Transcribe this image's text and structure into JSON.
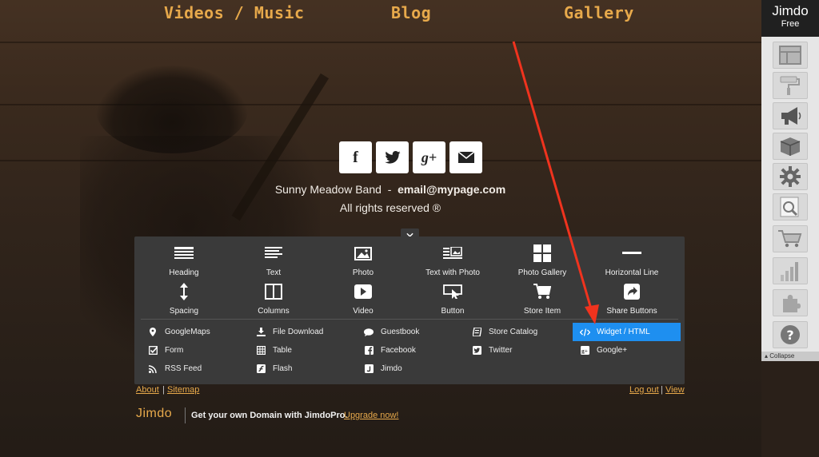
{
  "nav": {
    "items": [
      "Videos / Music",
      "Blog",
      "Gallery"
    ]
  },
  "social": {
    "buttons": [
      "f",
      "t",
      "g+",
      "mail"
    ]
  },
  "footer": {
    "band": "Sunny Meadow Band",
    "dash": "-",
    "email": "email@mypage.com",
    "rights": "All rights reserved ®"
  },
  "panel": {
    "close": "✕",
    "big_items": [
      {
        "label": "Heading",
        "icon": "heading-icon"
      },
      {
        "label": "Text",
        "icon": "text-icon"
      },
      {
        "label": "Photo",
        "icon": "photo-icon"
      },
      {
        "label": "Text with Photo",
        "icon": "text-with-photo-icon"
      },
      {
        "label": "Photo Gallery",
        "icon": "photo-gallery-icon"
      },
      {
        "label": "Horizontal Line",
        "icon": "horizontal-line-icon"
      },
      {
        "label": "Spacing",
        "icon": "spacing-icon"
      },
      {
        "label": "Columns",
        "icon": "columns-icon"
      },
      {
        "label": "Video",
        "icon": "video-icon"
      },
      {
        "label": "Button",
        "icon": "button-icon"
      },
      {
        "label": "Store Item",
        "icon": "cart-icon"
      },
      {
        "label": "Share Buttons",
        "icon": "share-icon"
      }
    ],
    "small_items": [
      {
        "label": "GoogleMaps",
        "icon": "map-pin-icon"
      },
      {
        "label": "File Download",
        "icon": "download-icon"
      },
      {
        "label": "Guestbook",
        "icon": "speech-bubble-icon"
      },
      {
        "label": "Store Catalog",
        "icon": "catalog-icon"
      },
      {
        "label": "Widget / HTML",
        "icon": "code-icon",
        "active": true
      },
      {
        "label": "Form",
        "icon": "checkbox-icon"
      },
      {
        "label": "Table",
        "icon": "table-icon"
      },
      {
        "label": "Facebook",
        "icon": "facebook-icon"
      },
      {
        "label": "Twitter",
        "icon": "twitter-icon"
      },
      {
        "label": "Google+",
        "icon": "google-plus-icon"
      },
      {
        "label": "RSS Feed",
        "icon": "rss-icon"
      },
      {
        "label": "Flash",
        "icon": "flash-icon"
      },
      {
        "label": "Jimdo",
        "icon": "jimdo-icon"
      }
    ]
  },
  "links": {
    "about": "About",
    "sitemap": "Sitemap",
    "logout": "Log out",
    "view": "View",
    "separator": "|"
  },
  "promo": {
    "logo": "Jimdo",
    "text": "Get your own Domain with JimdoPro.",
    "upgrade": "Upgrade now!"
  },
  "sidebar": {
    "title": "Jimdo",
    "subtitle": "Free",
    "buttons": [
      "layout-icon",
      "paint-roller-icon",
      "megaphone-icon",
      "box-icon",
      "gear-icon",
      "seo-magnifier-icon",
      "shopping-cart-icon",
      "statistics-icon",
      "puzzle-icon",
      "help-icon"
    ],
    "collapse": "Collapse"
  },
  "colors": {
    "accent": "#e7a94b",
    "panel": "#3a3a3a",
    "active": "#1e8ff0",
    "arrow": "#f0331e"
  }
}
